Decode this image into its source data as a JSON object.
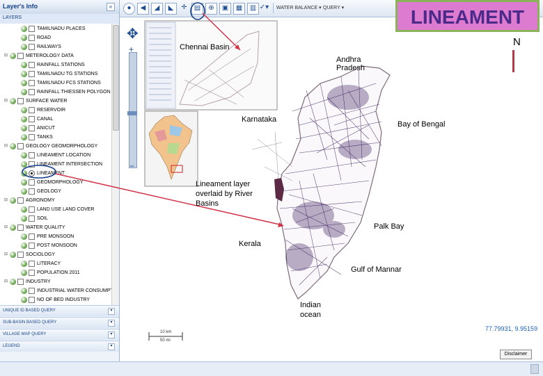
{
  "left_panel": {
    "title": "Layer's Info",
    "collapse_icon": "double-chevron-left-icon",
    "layers_label": "LAYERS",
    "tree": [
      {
        "label": "TAMILNADU PLACES",
        "level": 2,
        "kind": "check"
      },
      {
        "label": "ROAD",
        "level": 2,
        "kind": "check"
      },
      {
        "label": "RAILWAYS",
        "level": 2,
        "kind": "check"
      },
      {
        "label": "METEROLOGY DATA",
        "level": 1,
        "kind": "group"
      },
      {
        "label": "RAINFALL STATIONS",
        "level": 2,
        "kind": "check"
      },
      {
        "label": "TAMILNADU TG STATIONS",
        "level": 2,
        "kind": "check"
      },
      {
        "label": "TAMILNADU FCS STATIONS",
        "level": 2,
        "kind": "check"
      },
      {
        "label": "RAINFALL THIESSEN POLYGON",
        "level": 2,
        "kind": "check"
      },
      {
        "label": "SURFACE WATER",
        "level": 1,
        "kind": "group"
      },
      {
        "label": "RESERVOIR",
        "level": 2,
        "kind": "check"
      },
      {
        "label": "CANAL",
        "level": 2,
        "kind": "check"
      },
      {
        "label": "ANICUT",
        "level": 2,
        "kind": "check"
      },
      {
        "label": "TANKS",
        "level": 2,
        "kind": "check"
      },
      {
        "label": "GEOLOGY GEOMORPHOLOGY",
        "level": 1,
        "kind": "group"
      },
      {
        "label": "LINEAMENT LOCATION",
        "level": 2,
        "kind": "check"
      },
      {
        "label": "LINEAMENT INTERSECTION",
        "level": 2,
        "kind": "check"
      },
      {
        "label": "LINEAMENT",
        "level": 2,
        "kind": "radio",
        "selected": true
      },
      {
        "label": "GEOMORPHOLOGY",
        "level": 2,
        "kind": "check"
      },
      {
        "label": "GEOLOGY",
        "level": 2,
        "kind": "check"
      },
      {
        "label": "AGRONOMY",
        "level": 1,
        "kind": "group"
      },
      {
        "label": "LAND USE LAND COVER",
        "level": 2,
        "kind": "check"
      },
      {
        "label": "SOIL",
        "level": 2,
        "kind": "check"
      },
      {
        "label": "WATER QUALITY",
        "level": 1,
        "kind": "group"
      },
      {
        "label": "PRE MONSOON",
        "level": 2,
        "kind": "check"
      },
      {
        "label": "POST MONSOON",
        "level": 2,
        "kind": "check"
      },
      {
        "label": "SOCIOLOGY",
        "level": 1,
        "kind": "group"
      },
      {
        "label": "LITERACY",
        "level": 2,
        "kind": "check"
      },
      {
        "label": "POPULATION 2011",
        "level": 2,
        "kind": "check"
      },
      {
        "label": "INDUSTRY",
        "level": 1,
        "kind": "group"
      },
      {
        "label": "INDUSTRIAL WATER CONSUMPTIO",
        "level": 2,
        "kind": "check"
      },
      {
        "label": "NO OF BED INDUSTRY",
        "level": 2,
        "kind": "check"
      }
    ],
    "accordions": [
      {
        "label": "UNIQUE ID BASED QUERY"
      },
      {
        "label": "SUB-BASIN BASED QUERY"
      },
      {
        "label": "VILLAGE MAP QUERY"
      },
      {
        "label": "LEGEND"
      }
    ]
  },
  "toolbar": {
    "icons": [
      "globe-icon",
      "pan-left-icon",
      "zoom-in-icon",
      "zoom-out-icon",
      "pan-icon",
      "info-icon",
      "identify-icon",
      "print-icon",
      "save-icon",
      "export-icon",
      "select-icon"
    ],
    "menus": [
      "WATER BALANCE",
      "QUERY"
    ]
  },
  "map": {
    "title": "LINEAMENT",
    "north": "N",
    "labels": {
      "chennai": "Chennai Basin",
      "andhra": "Andhra Pradesh",
      "karnataka": "Karnataka",
      "bay": "Bay of Bengal",
      "lineament_note": "Lineament layer overlaid by River Basins",
      "palk": "Palk Bay",
      "kerala": "Kerala",
      "mannar": "Gulf of Mannar",
      "indian_ocean": "Indian ocean"
    },
    "coordinates": "77.79931, 9.95159",
    "scale_top": "10 km",
    "scale_bottom": "50 mi",
    "disclaimer": "Disclaimer"
  },
  "colors": {
    "accent": "#15428b",
    "annotation_red": "#d2344a",
    "badge_fill": "#dd7bd0",
    "badge_border": "#8bb45a",
    "badge_text": "#4b2a8a"
  }
}
